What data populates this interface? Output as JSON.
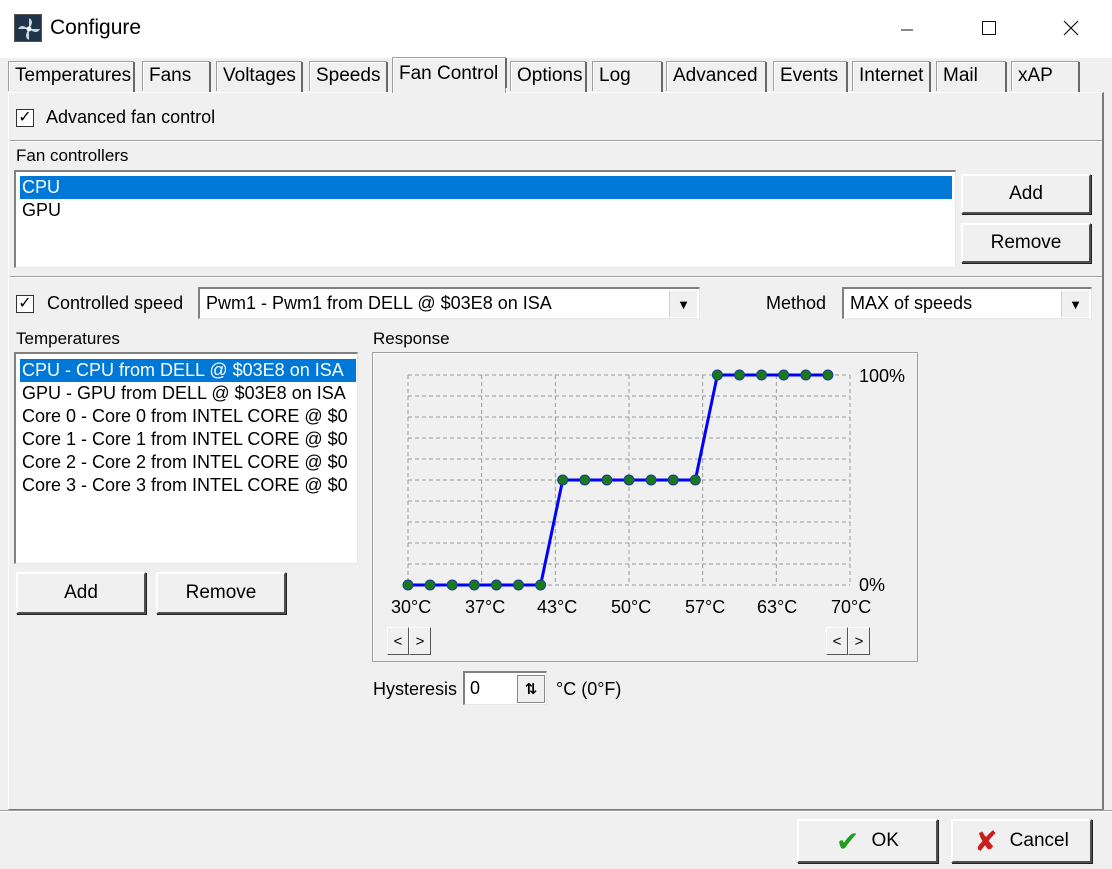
{
  "window": {
    "title": "Configure"
  },
  "tabs": [
    {
      "label": "Temperatures"
    },
    {
      "label": "Fans"
    },
    {
      "label": "Voltages"
    },
    {
      "label": "Speeds"
    },
    {
      "label": "Fan Control"
    },
    {
      "label": "Options"
    },
    {
      "label": "Log"
    },
    {
      "label": "Advanced"
    },
    {
      "label": "Events"
    },
    {
      "label": "Internet"
    },
    {
      "label": "Mail"
    },
    {
      "label": "xAP"
    }
  ],
  "active_tab": "Fan Control",
  "advanced_fan_control": {
    "label": "Advanced fan control",
    "checked": true
  },
  "fan_controllers": {
    "label": "Fan controllers",
    "items": [
      {
        "label": "CPU",
        "selected": true
      },
      {
        "label": "GPU",
        "selected": false
      }
    ],
    "add_label": "Add",
    "remove_label": "Remove"
  },
  "controlled_speed": {
    "label": "Controlled speed",
    "checked": true,
    "value": "Pwm1 - Pwm1 from DELL @ $03E8 on ISA"
  },
  "method": {
    "label": "Method",
    "value": "MAX of speeds"
  },
  "temperatures": {
    "label": "Temperatures",
    "items": [
      {
        "label": "CPU - CPU from DELL @ $03E8 on ISA",
        "selected": true
      },
      {
        "label": "GPU - GPU from DELL @ $03E8 on ISA",
        "selected": false
      },
      {
        "label": "Core 0 - Core 0 from INTEL CORE @ $0",
        "selected": false
      },
      {
        "label": "Core 1 - Core 1 from INTEL CORE @ $0",
        "selected": false
      },
      {
        "label": "Core 2 - Core 2 from INTEL CORE @ $0",
        "selected": false
      },
      {
        "label": "Core 3 - Core 3 from INTEL CORE @ $0",
        "selected": false
      }
    ],
    "add_label": "Add",
    "remove_label": "Remove"
  },
  "response": {
    "label": "Response",
    "left_arrow": "<",
    "right_arrow": ">"
  },
  "hysteresis": {
    "label": "Hysteresis",
    "value": "0",
    "unit": "°C (0°F)"
  },
  "footer": {
    "ok_label": "OK",
    "cancel_label": "Cancel"
  },
  "icons": {
    "app": "fan-icon",
    "minimize": "minimize-icon",
    "maximize": "maximize-icon",
    "close": "close-icon",
    "ok": "checkmark-icon",
    "cancel": "x-icon",
    "dropdown": "chevron-down-icon",
    "spin": "spin-arrows-icon"
  },
  "colors": {
    "selection": "#0078d7",
    "line": "#0000ff",
    "point": "#1a7a1a",
    "ok_icon": "#1e9e1e",
    "cancel_icon": "#c81e1e"
  },
  "chart_data": {
    "type": "line",
    "x_tick_labels": [
      "30°C",
      "37°C",
      "43°C",
      "50°C",
      "57°C",
      "63°C",
      "70°C"
    ],
    "y_tick_labels": [
      "0%",
      "100%"
    ],
    "x_unit": "°C",
    "y_unit": "%",
    "xlim": [
      30,
      70
    ],
    "ylim": [
      0,
      100
    ],
    "grid": true,
    "series": [
      {
        "x": [
          30,
          32,
          34,
          36,
          38,
          40,
          42,
          44,
          46,
          48,
          50,
          52,
          54,
          56,
          58,
          60,
          62,
          64,
          66,
          68
        ],
        "y": [
          0,
          0,
          0,
          0,
          0,
          0,
          0,
          50,
          50,
          50,
          50,
          50,
          50,
          50,
          100,
          100,
          100,
          100,
          100,
          100
        ]
      }
    ]
  }
}
